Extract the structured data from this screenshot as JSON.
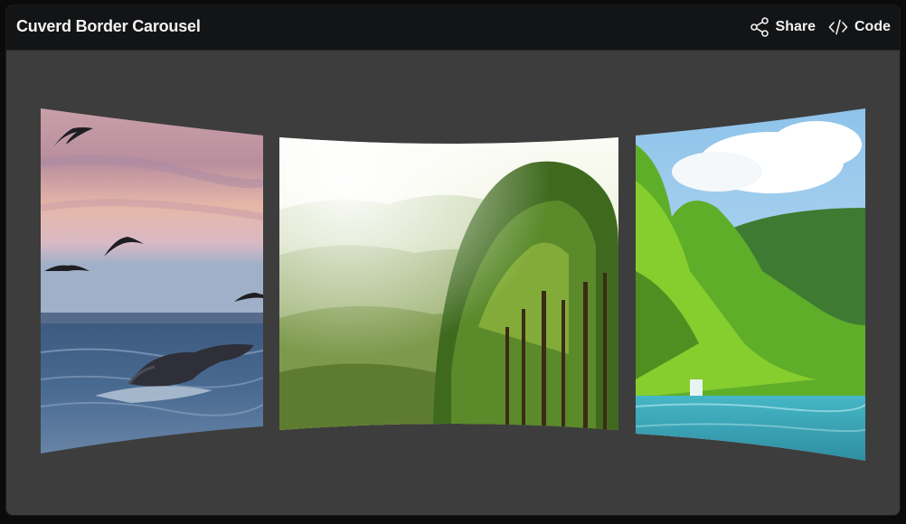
{
  "header": {
    "title": "Cuverd Border Carousel",
    "share_label": "Share",
    "code_label": "Code"
  },
  "carousel": {
    "slides": [
      {
        "subject": "ocean-whale-birds-sunset"
      },
      {
        "subject": "forest-trees-sunlight"
      },
      {
        "subject": "lake-waterfall-green-hills"
      }
    ]
  },
  "colors": {
    "header_bg": "#131416",
    "stage_bg": "#3d3d3d",
    "text": "#f2f2f2"
  }
}
